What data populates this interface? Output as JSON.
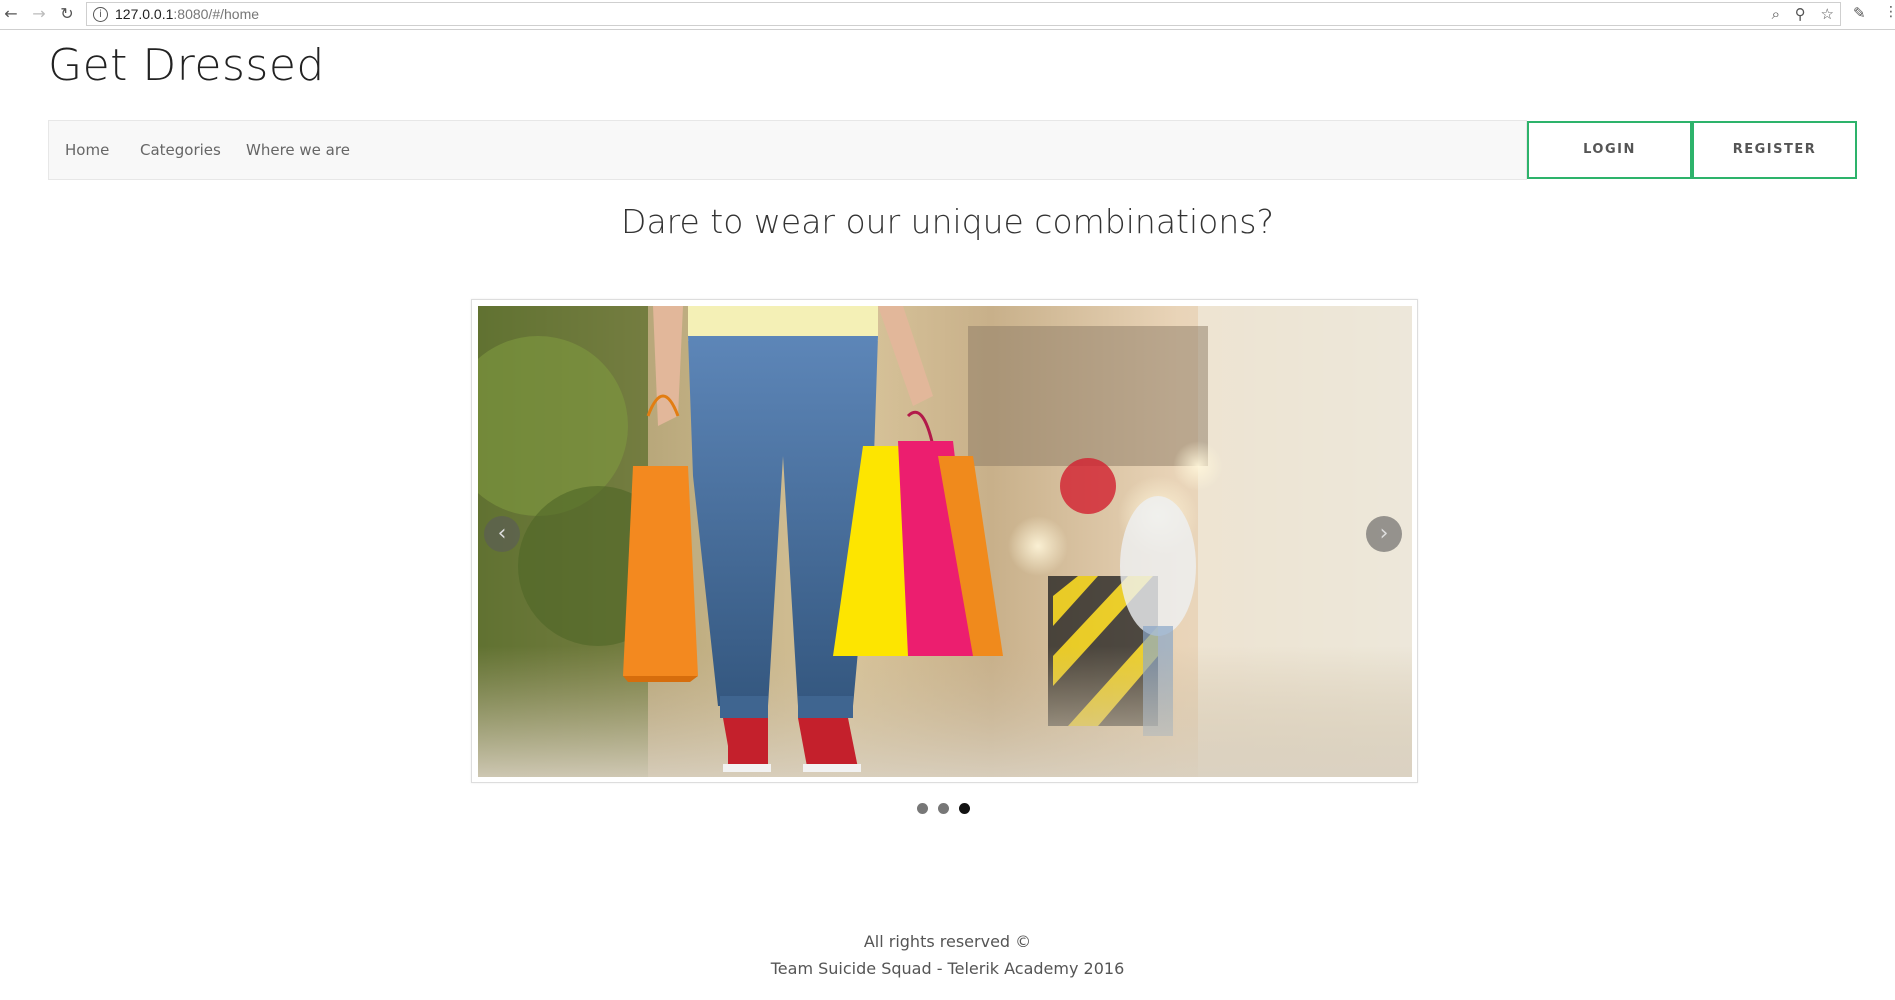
{
  "browser": {
    "url_host": "127.0.0.1",
    "url_rest": ":8080/#/home"
  },
  "header": {
    "site_title": "Get Dressed"
  },
  "nav": {
    "links": [
      "Home",
      "Categories",
      "Where we are"
    ],
    "login_label": "LOGIN",
    "register_label": "REGISTER"
  },
  "main": {
    "tagline": "Dare to wear our unique combinations?",
    "carousel": {
      "slide_count": 3,
      "active_index": 2,
      "prev_arrow": "‹",
      "next_arrow": "›"
    }
  },
  "footer": {
    "line1": "All rights reserved ©",
    "line2": "Team Suicide Squad - Telerik Academy 2016"
  },
  "colors": {
    "accent": "#2db36b",
    "navbar_bg": "#f8f8f8"
  }
}
